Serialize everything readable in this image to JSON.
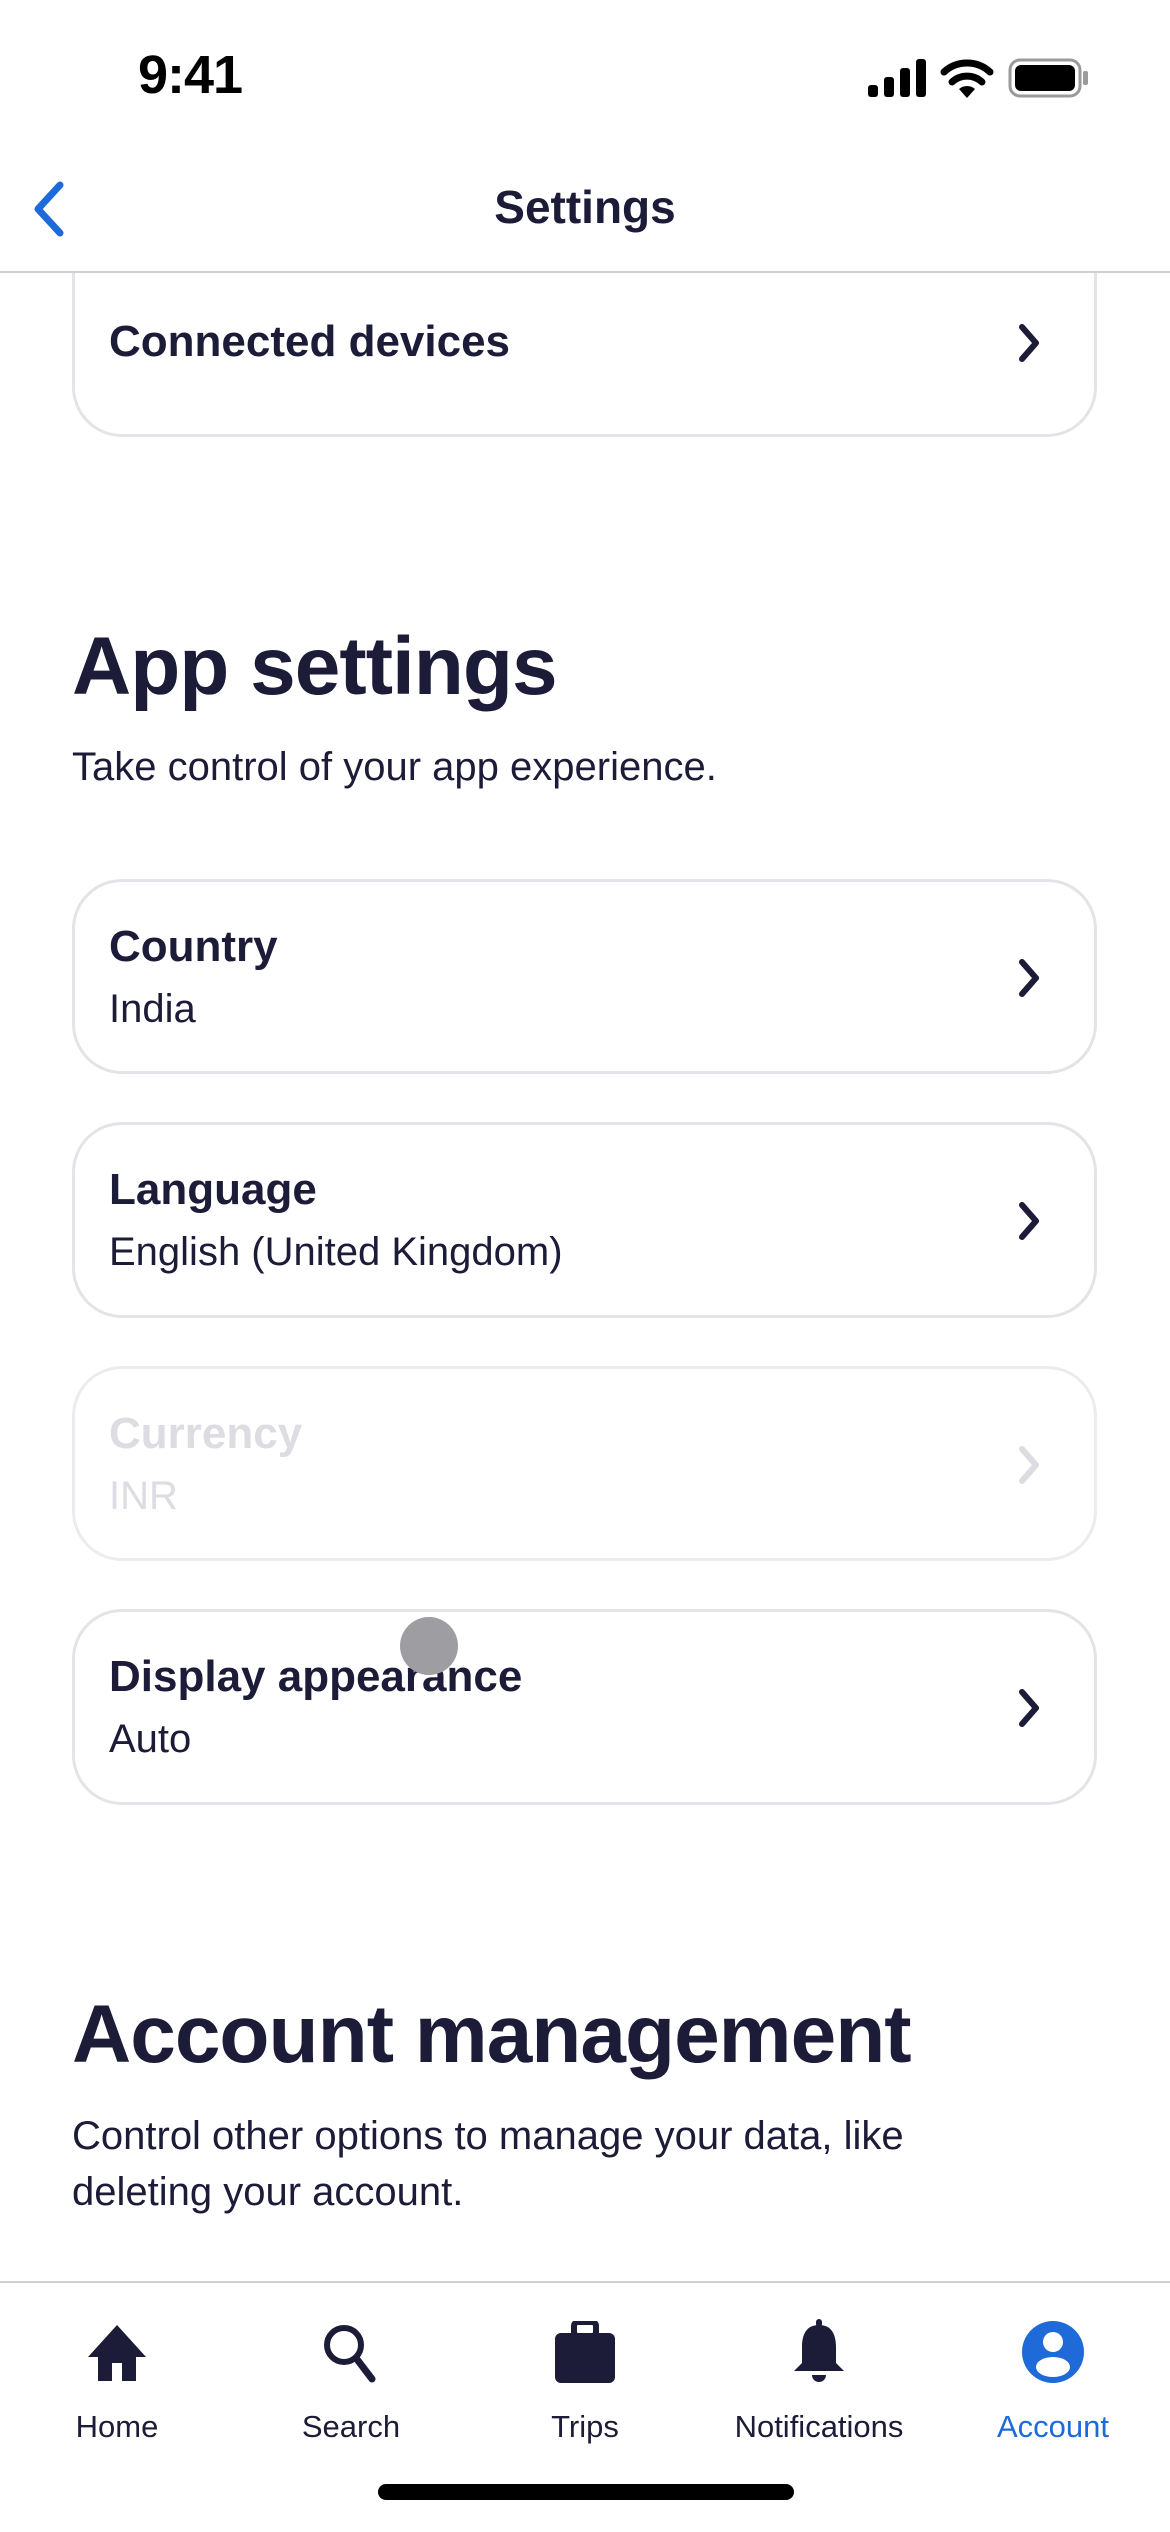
{
  "status_bar": {
    "time": "9:41",
    "icons": [
      "cellular-signal-icon",
      "wifi-icon",
      "battery-icon"
    ]
  },
  "nav": {
    "title": "Settings",
    "back_icon": "chevron-left-icon"
  },
  "colors": {
    "accent": "#1e6ad8",
    "text_primary": "#1c1b38",
    "text_disabled": "#dcdce2",
    "card_border": "#e4e4e8"
  },
  "previous_section": {
    "items": [
      {
        "title": "Connected devices"
      }
    ]
  },
  "app_settings": {
    "heading": "App settings",
    "description": "Take control of your app experience.",
    "items": [
      {
        "title": "Country",
        "value": "India",
        "disabled": false
      },
      {
        "title": "Language",
        "value": "English (United Kingdom)",
        "disabled": false
      },
      {
        "title": "Currency",
        "value": "INR",
        "disabled": true
      },
      {
        "title": "Display appearance",
        "value": "Auto",
        "disabled": false
      }
    ]
  },
  "account_management": {
    "heading": "Account management",
    "description": "Control other options to manage your data, like deleting your account."
  },
  "tab_bar": {
    "tabs": [
      {
        "label": "Home",
        "icon": "home-icon",
        "active": false
      },
      {
        "label": "Search",
        "icon": "search-icon",
        "active": false
      },
      {
        "label": "Trips",
        "icon": "briefcase-icon",
        "active": false
      },
      {
        "label": "Notifications",
        "icon": "bell-icon",
        "active": false
      },
      {
        "label": "Account",
        "icon": "account-circle-icon",
        "active": true
      }
    ]
  }
}
